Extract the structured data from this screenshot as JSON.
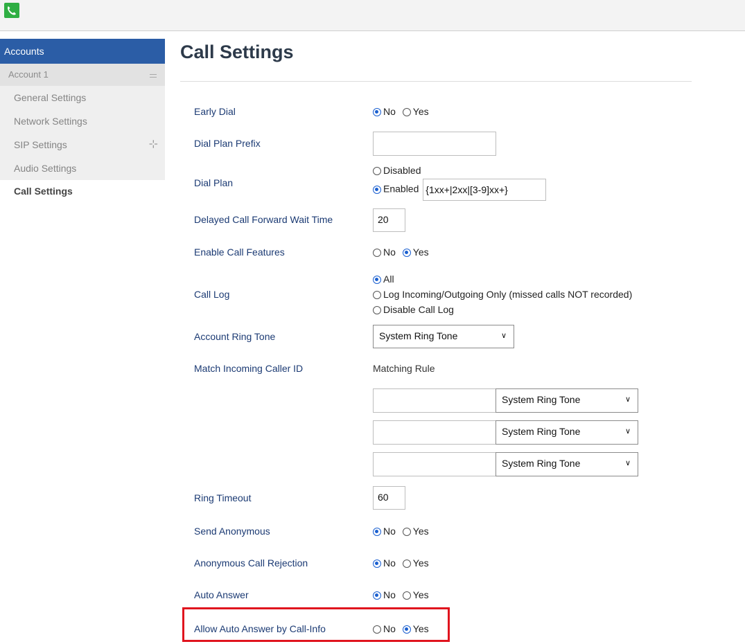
{
  "sidebar": {
    "header": "Accounts",
    "account": "Account 1",
    "items": [
      {
        "label": "General Settings"
      },
      {
        "label": "Network Settings"
      },
      {
        "label": "SIP Settings"
      },
      {
        "label": "Audio Settings"
      }
    ],
    "active": "Call Settings"
  },
  "page": {
    "title": "Call Settings"
  },
  "radio_no": "No",
  "radio_yes": "Yes",
  "settings": {
    "early_dial": {
      "label": "Early Dial",
      "value": "No"
    },
    "dial_plan_prefix": {
      "label": "Dial Plan Prefix",
      "value": ""
    },
    "dial_plan": {
      "label": "Dial Plan",
      "disabled_label": "Disabled",
      "enabled_label": "Enabled",
      "value": "{1xx+|2xx|[3-9]xx+}"
    },
    "delayed_forward": {
      "label": "Delayed Call Forward Wait Time",
      "value": "20"
    },
    "enable_call_features": {
      "label": "Enable Call Features",
      "value": "Yes"
    },
    "call_log": {
      "label": "Call Log",
      "options": [
        "All",
        "Log Incoming/Outgoing Only (missed calls NOT recorded)",
        "Disable Call Log"
      ],
      "value": "All"
    },
    "account_ring_tone": {
      "label": "Account Ring Tone",
      "value": "System Ring Tone"
    },
    "match_incoming": {
      "label": "Match Incoming Caller ID",
      "sub_label": "Matching Rule",
      "rules": [
        {
          "pattern": "",
          "tone": "System Ring Tone"
        },
        {
          "pattern": "",
          "tone": "System Ring Tone"
        },
        {
          "pattern": "",
          "tone": "System Ring Tone"
        }
      ]
    },
    "ring_timeout": {
      "label": "Ring Timeout",
      "value": "60"
    },
    "send_anonymous": {
      "label": "Send Anonymous",
      "value": "No"
    },
    "anonymous_rejection": {
      "label": "Anonymous Call Rejection",
      "value": "No"
    },
    "auto_answer": {
      "label": "Auto Answer",
      "value": "No"
    },
    "auto_answer_call_info": {
      "label": "Allow Auto Answer by Call-Info",
      "value": "Yes"
    }
  },
  "colors": {
    "sidebar_header": "#2b5da6",
    "label": "#1b3a73",
    "radio_on": "#1a5fd0",
    "highlight": "#e0141e"
  }
}
